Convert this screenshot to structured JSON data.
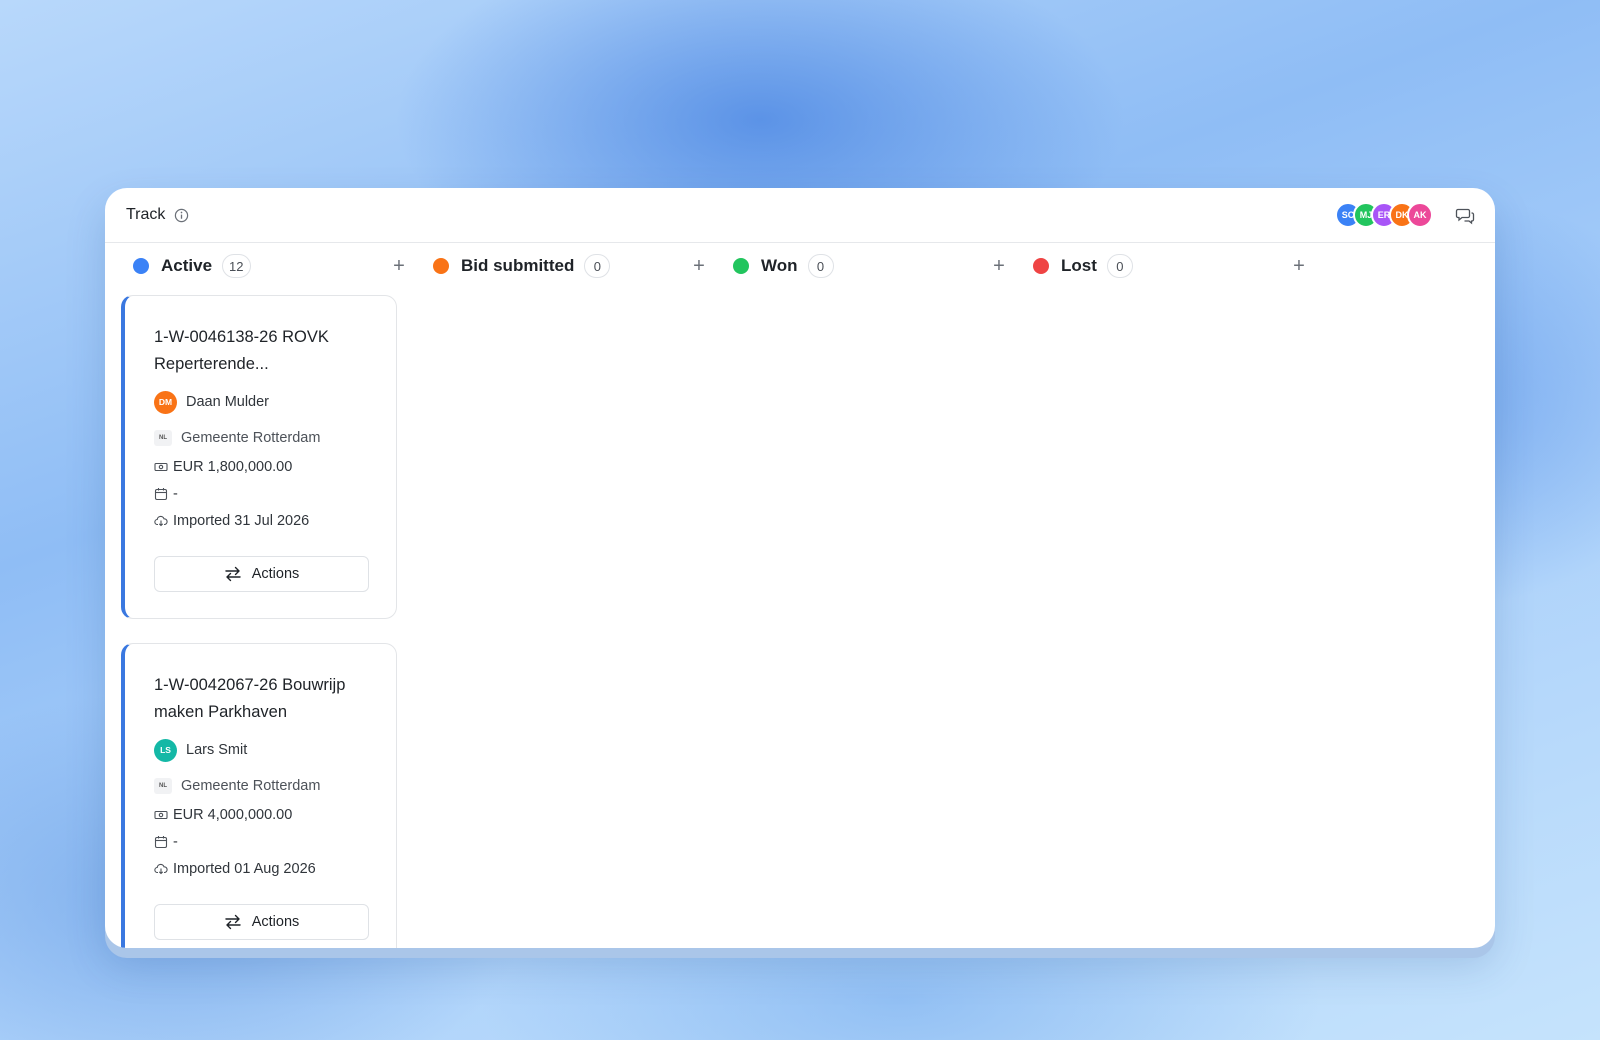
{
  "header": {
    "title": "Track",
    "avatars": [
      {
        "initials": "SC",
        "color": "#3b82f6"
      },
      {
        "initials": "MJ",
        "color": "#22c55e"
      },
      {
        "initials": "ER",
        "color": "#a855f7"
      },
      {
        "initials": "DK",
        "color": "#f97316"
      },
      {
        "initials": "AK",
        "color": "#ec4899"
      }
    ]
  },
  "columns": [
    {
      "name": "Active",
      "count": "12",
      "color": "#3b82f6"
    },
    {
      "name": "Bid submitted",
      "count": "0",
      "color": "#f97316"
    },
    {
      "name": "Won",
      "count": "0",
      "color": "#22c55e"
    },
    {
      "name": "Lost",
      "count": "0",
      "color": "#ef4444"
    }
  ],
  "cards": [
    {
      "title": "1-W-0046138-26 ROVK Reperterende...",
      "owner_initials": "DM",
      "owner_color": "#f97316",
      "owner_name": "Daan Mulder",
      "country": "NL",
      "organization": "Gemeente Rotterdam",
      "amount": "EUR 1,800,000.00",
      "date": "-",
      "imported": "Imported 31 Jul 2026",
      "actions_label": "Actions"
    },
    {
      "title": "1-W-0042067-26 Bouwrijp maken Parkhaven",
      "owner_initials": "LS",
      "owner_color": "#14b8a6",
      "owner_name": "Lars Smit",
      "country": "NL",
      "organization": "Gemeente Rotterdam",
      "amount": "EUR 4,000,000.00",
      "date": "-",
      "imported": "Imported 01 Aug 2026",
      "actions_label": "Actions"
    }
  ]
}
